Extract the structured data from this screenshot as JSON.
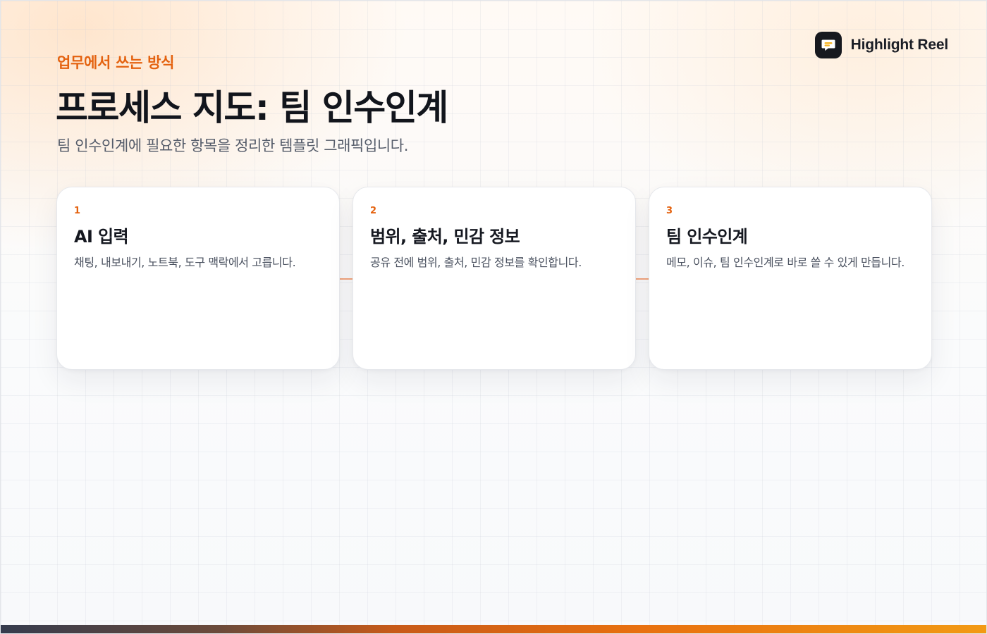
{
  "brand": {
    "name": "Highlight Reel",
    "logo_icon": "chat-bubble-icon",
    "logo_bg": "#17191f",
    "logo_accent": "#f5b324"
  },
  "header": {
    "eyebrow": "업무에서 쓰는 방식",
    "title": "프로세스 지도: 팀 인수인계",
    "subtitle": "팀 인수인계에 필요한 항목을 정리한 템플릿 그래픽입니다."
  },
  "steps": [
    {
      "number": "1",
      "title": "AI 입력",
      "description": "채팅, 내보내기, 노트북, 도구 맥락에서 고릅니다."
    },
    {
      "number": "2",
      "title": "범위, 출처, 민감 정보",
      "description": "공유 전에 범위, 출처, 민감 정보를 확인합니다."
    },
    {
      "number": "3",
      "title": "팀 인수인계",
      "description": "메모, 이슈, 팀 인수인계로 바로 쓸 수 있게 만듭니다."
    }
  ],
  "colors": {
    "accent": "#e4620f",
    "connector": "#f4a57c",
    "title": "#12151c"
  }
}
